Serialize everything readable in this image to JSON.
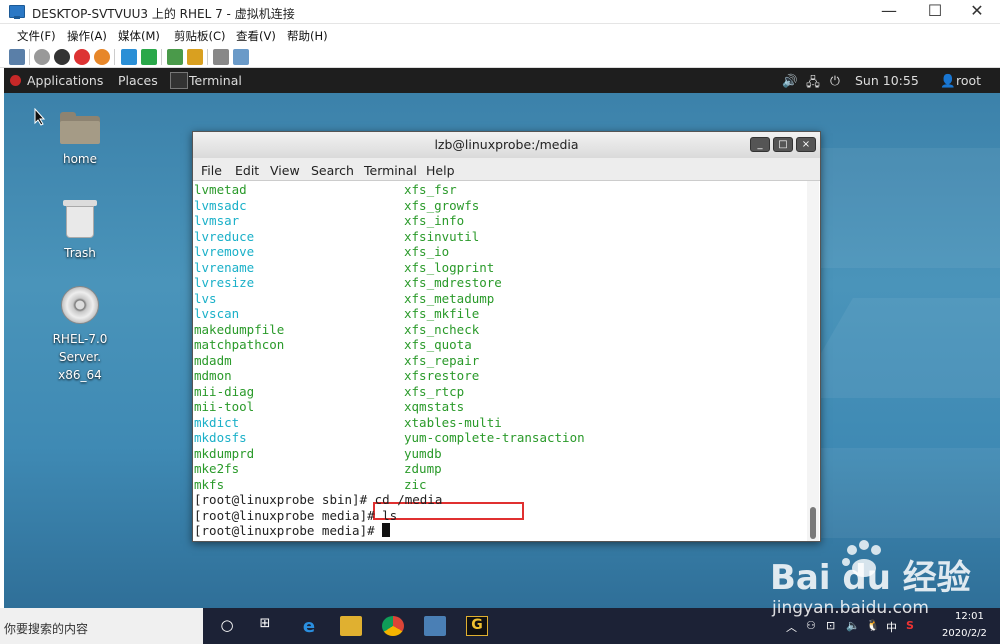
{
  "host": {
    "title": "DESKTOP-SVTVUU3 上的 RHEL 7 - 虚拟机连接",
    "window_buttons": [
      "—",
      "☐",
      "✕"
    ],
    "menu": [
      "文件(F)",
      "操作(A)",
      "媒体(M)",
      "剪贴板(C)",
      "查看(V)",
      "帮助(H)"
    ]
  },
  "gnome": {
    "applications": "Applications",
    "places": "Places",
    "task": "Terminal",
    "clock": "Sun 10:55",
    "user": "root"
  },
  "desktop": {
    "icons": [
      {
        "label": "home"
      },
      {
        "label": "Trash"
      },
      {
        "label_line1": "RHEL-7.0 Server.",
        "label_line2": "x86_64"
      }
    ]
  },
  "terminal": {
    "title": "lzb@linuxprobe:/media",
    "menu": [
      "File",
      "Edit",
      "View",
      "Search",
      "Terminal",
      "Help"
    ],
    "listing": [
      {
        "c1": "lvmetad",
        "c1color": "green",
        "c2": "xfs_fsr"
      },
      {
        "c1": "lvmsadc",
        "c1color": "cyan",
        "c2": "xfs_growfs"
      },
      {
        "c1": "lvmsar",
        "c1color": "cyan",
        "c2": "xfs_info"
      },
      {
        "c1": "lvreduce",
        "c1color": "cyan",
        "c2": "xfsinvutil"
      },
      {
        "c1": "lvremove",
        "c1color": "cyan",
        "c2": "xfs_io"
      },
      {
        "c1": "lvrename",
        "c1color": "cyan",
        "c2": "xfs_logprint"
      },
      {
        "c1": "lvresize",
        "c1color": "cyan",
        "c2": "xfs_mdrestore"
      },
      {
        "c1": "lvs",
        "c1color": "cyan",
        "c2": "xfs_metadump"
      },
      {
        "c1": "lvscan",
        "c1color": "cyan",
        "c2": "xfs_mkfile"
      },
      {
        "c1": "makedumpfile",
        "c1color": "green",
        "c2": "xfs_ncheck"
      },
      {
        "c1": "matchpathcon",
        "c1color": "green",
        "c2": "xfs_quota"
      },
      {
        "c1": "mdadm",
        "c1color": "green",
        "c2": "xfs_repair"
      },
      {
        "c1": "mdmon",
        "c1color": "green",
        "c2": "xfsrestore"
      },
      {
        "c1": "mii-diag",
        "c1color": "green",
        "c2": "xfs_rtcp"
      },
      {
        "c1": "mii-tool",
        "c1color": "green",
        "c2": "xqmstats"
      },
      {
        "c1": "mkdict",
        "c1color": "cyan",
        "c2": "xtables-multi"
      },
      {
        "c1": "mkdosfs",
        "c1color": "cyan",
        "c2": "yum-complete-transaction"
      },
      {
        "c1": "mkdumprd",
        "c1color": "green",
        "c2": "yumdb"
      },
      {
        "c1": "mke2fs",
        "c1color": "green",
        "c2": "zdump"
      },
      {
        "c1": "mkfs",
        "c1color": "green",
        "c2": "zic"
      }
    ],
    "commands": [
      {
        "prompt": "[root@linuxprobe sbin]# ",
        "cmd": "cd /media"
      },
      {
        "prompt": "[root@linuxprobe media]# ",
        "cmd": "ls"
      },
      {
        "prompt": "[root@linuxprobe media]# ",
        "cmd": ""
      }
    ]
  },
  "taskbar": {
    "search_placeholder": "你要搜索的内容",
    "ime": "中",
    "time": "12:01",
    "date": "2020/2/2"
  },
  "watermark": {
    "brand": "Bai du 经验",
    "url": "jingyan.baidu.com"
  },
  "colors": {
    "green": "#2a9a2a",
    "cyan": "#1ab0c8",
    "highlight_box": "#e03030"
  }
}
